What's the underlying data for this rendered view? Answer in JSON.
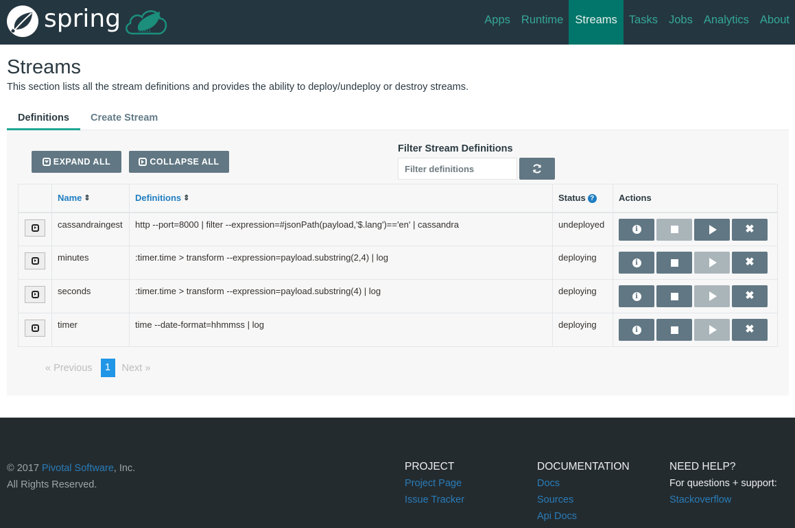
{
  "brand": {
    "name": "spring",
    "cloud_logo": "spring-cloud-dataflow-logo"
  },
  "nav": {
    "items": [
      {
        "label": "Apps",
        "active": false
      },
      {
        "label": "Runtime",
        "active": false
      },
      {
        "label": "Streams",
        "active": true
      },
      {
        "label": "Tasks",
        "active": false
      },
      {
        "label": "Jobs",
        "active": false
      },
      {
        "label": "Analytics",
        "active": false
      },
      {
        "label": "About",
        "active": false
      }
    ]
  },
  "page": {
    "title": "Streams",
    "description": "This section lists all the stream definitions and provides the ability to deploy/undeploy or destroy streams."
  },
  "tabs": [
    {
      "label": "Definitions",
      "active": true
    },
    {
      "label": "Create Stream",
      "active": false
    }
  ],
  "toolbar": {
    "expand_all": "EXPAND ALL",
    "collapse_all": "COLLAPSE ALL",
    "filter_label": "Filter Stream Definitions",
    "filter_placeholder": "Filter definitions",
    "filter_value": "",
    "refresh_icon": "refresh-icon"
  },
  "table": {
    "columns": {
      "name": "Name",
      "definitions": "Definitions",
      "status": "Status",
      "actions": "Actions"
    },
    "rows": [
      {
        "name": "cassandraingest",
        "definition": "http --port=8000 | filter --expression=#jsonPath(payload,'$.lang')=='en' | cassandra",
        "status": "undeployed",
        "actions": {
          "info": true,
          "undeploy": false,
          "deploy": true,
          "destroy": true
        }
      },
      {
        "name": "minutes",
        "definition": ":timer.time > transform --expression=payload.substring(2,4) | log",
        "status": "deploying",
        "actions": {
          "info": true,
          "undeploy": true,
          "deploy": false,
          "destroy": true
        }
      },
      {
        "name": "seconds",
        "definition": ":timer.time > transform --expression=payload.substring(4) | log",
        "status": "deploying",
        "actions": {
          "info": true,
          "undeploy": true,
          "deploy": false,
          "destroy": true
        }
      },
      {
        "name": "timer",
        "definition": "time --date-format=hhmmss | log",
        "status": "deploying",
        "actions": {
          "info": true,
          "undeploy": true,
          "deploy": false,
          "destroy": true
        }
      }
    ]
  },
  "pagination": {
    "prev": "«  Previous",
    "current": "1",
    "next": "Next  »"
  },
  "footer": {
    "copyright_prefix": "© 2017 ",
    "company_link": "Pivotal Software",
    "copyright_suffix": ", Inc.",
    "rights": "All Rights Reserved.",
    "project": {
      "title": "PROJECT",
      "links": [
        "Project Page",
        "Issue Tracker"
      ]
    },
    "documentation": {
      "title": "DOCUMENTATION",
      "links": [
        "Docs",
        "Sources",
        "Api Docs"
      ]
    },
    "help": {
      "title": "NEED HELP?",
      "text": "For questions + support:",
      "links": [
        "Stackoverflow"
      ]
    }
  },
  "colors": {
    "navbar_bg": "#243640",
    "nav_link": "#34a798",
    "nav_active_bg": "#02766a",
    "button_bg": "#617783",
    "button_disabled_bg": "#aab5ba",
    "link_blue": "#1f7ec2",
    "page_active": "#2196e6",
    "footer_bg": "#232b2f"
  }
}
